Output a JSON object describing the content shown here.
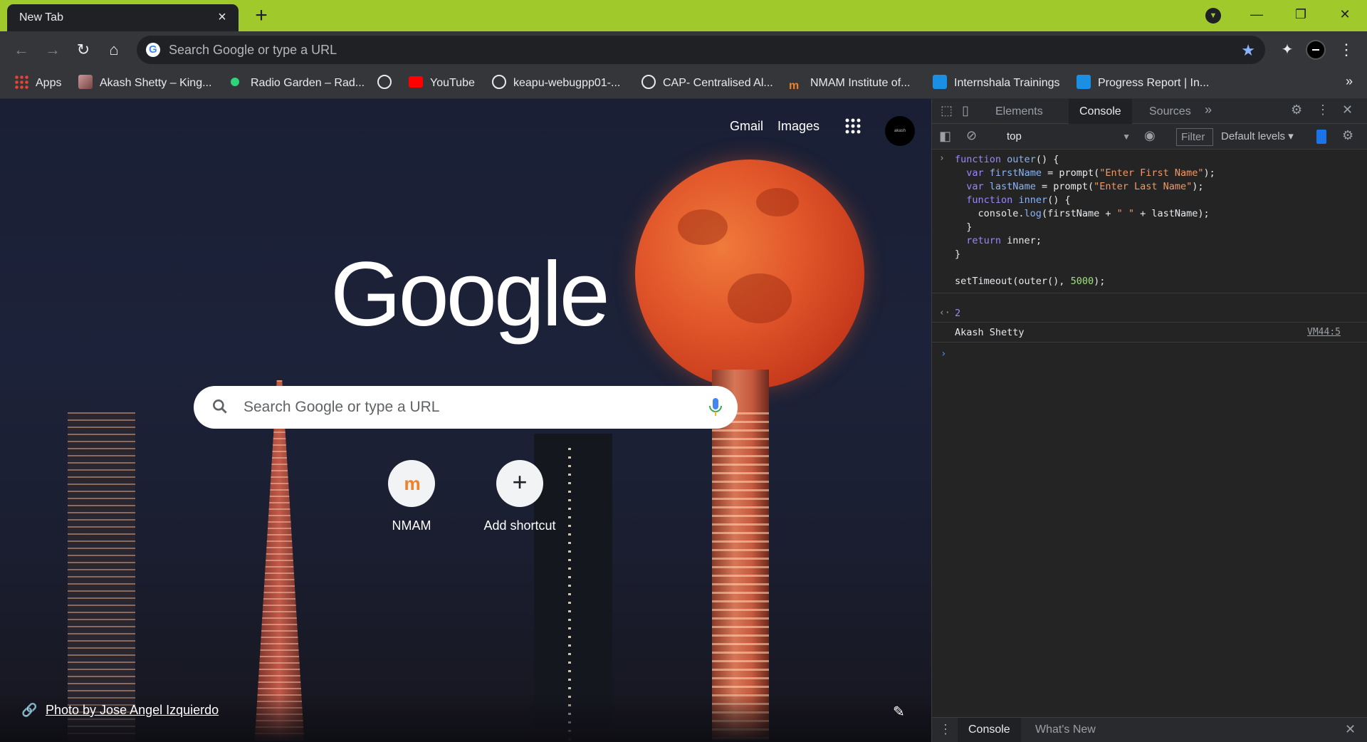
{
  "browser": {
    "tab_title": "New Tab",
    "omnibox_placeholder": "Search Google or type a URL",
    "accent_color": "#a0c92c"
  },
  "bookmarks": [
    {
      "label": "Apps",
      "icon": "apps-grid-icon"
    },
    {
      "label": "Akash Shetty – King...",
      "icon": "profile-photo-icon"
    },
    {
      "label": "Radio Garden – Rad...",
      "icon": "green-dot-icon"
    },
    {
      "label": "",
      "icon": "globe-icon"
    },
    {
      "label": "YouTube",
      "icon": "youtube-icon"
    },
    {
      "label": "keapu-webugpp01-...",
      "icon": "globe-icon"
    },
    {
      "label": "CAP- Centralised Al...",
      "icon": "globe-icon"
    },
    {
      "label": "NMAM Institute of...",
      "icon": "nmam-icon"
    },
    {
      "label": "Internshala Trainings",
      "icon": "internshala-icon"
    },
    {
      "label": "Progress Report | In...",
      "icon": "internshala-icon"
    }
  ],
  "ntp": {
    "top_links": [
      "Gmail",
      "Images"
    ],
    "avatar_text": "akash",
    "logo_text": "Google",
    "search_placeholder": "Search Google or type a URL",
    "shortcuts": [
      {
        "label": "NMAM",
        "icon": "nmam-icon"
      },
      {
        "label": "Add shortcut",
        "icon": "plus-icon"
      }
    ],
    "photo_credit": "Photo by Jose Angel Izquierdo"
  },
  "devtools": {
    "tabs": [
      "Elements",
      "Console",
      "Sources"
    ],
    "active_tab": "Console",
    "context": "top",
    "filter_placeholder": "Filter",
    "levels": "Default levels",
    "result_value": "2",
    "log_message": "Akash Shetty",
    "log_source": "VM44:5",
    "drawer_tabs": [
      "Console",
      "What's New"
    ],
    "code_lines": [
      "function outer() {",
      "  var firstName = prompt(\"Enter First Name\");",
      "  var lastName = prompt(\"Enter Last Name\");",
      "  function inner() {",
      "    console.log(firstName + \" \" + lastName);",
      "  }",
      "  return inner;",
      "}",
      "",
      "setTimeout(outer(), 5000);"
    ]
  }
}
